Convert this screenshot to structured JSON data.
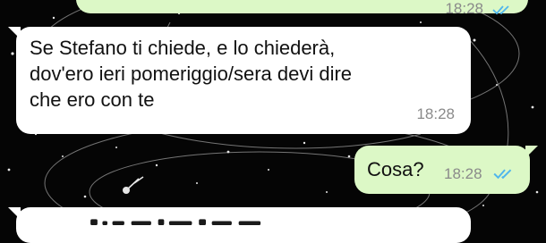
{
  "chat": {
    "messages": [
      {
        "direction": "out",
        "text": "",
        "time": "18:28",
        "read": true
      },
      {
        "direction": "in",
        "text_lines": [
          "Se Stefano ti chiede, e lo chiederà,",
          "dov'ero ieri pomeriggio/sera devi dire",
          "che ero con te"
        ],
        "time": "18:28"
      },
      {
        "direction": "out",
        "text": "Cosa?",
        "time": "18:28",
        "read": true
      },
      {
        "direction": "in",
        "text": "",
        "time": ""
      }
    ]
  },
  "colors": {
    "wallpaper": "#050505",
    "incoming_bubble": "#ffffff",
    "outgoing_bubble": "#dcf8c6",
    "timestamp": "#8a8a8a",
    "read_ticks": "#4fb6ec"
  },
  "icons": {
    "read_receipt": "double-check-icon"
  }
}
